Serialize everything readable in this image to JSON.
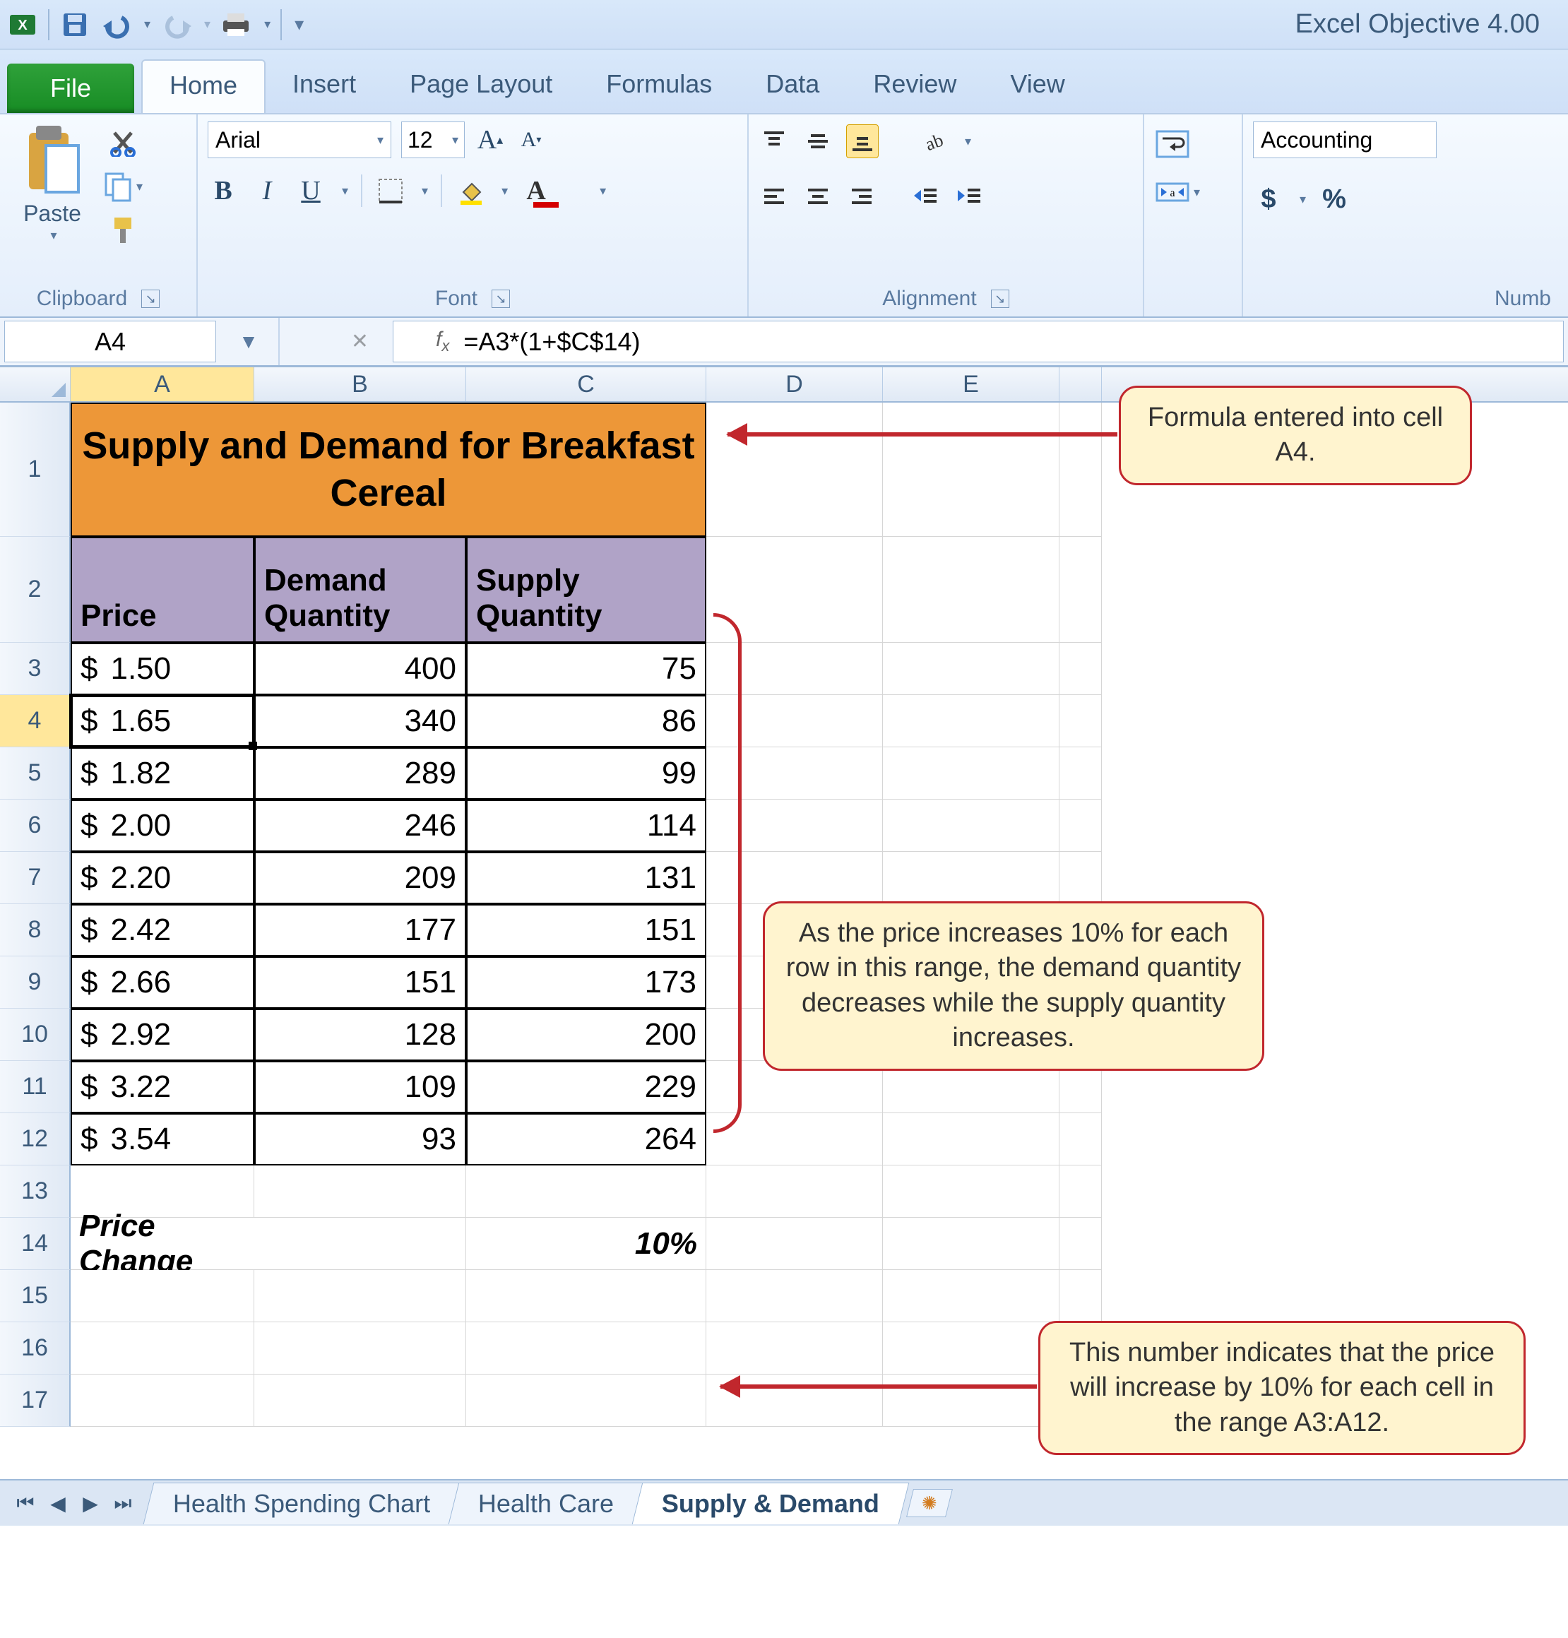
{
  "app_title": "Excel Objective 4.00",
  "tabs": {
    "file": "File",
    "items": [
      "Home",
      "Insert",
      "Page Layout",
      "Formulas",
      "Data",
      "Review",
      "View"
    ],
    "active": "Home"
  },
  "ribbon": {
    "clipboard": {
      "paste": "Paste",
      "label": "Clipboard"
    },
    "font": {
      "name": "Arial",
      "size": "12",
      "label": "Font"
    },
    "alignment": {
      "label": "Alignment"
    },
    "number": {
      "format": "Accounting",
      "label": "Numb"
    }
  },
  "name_box": "A4",
  "formula": "=A3*(1+$C$14)",
  "columns": [
    "A",
    "B",
    "C",
    "D",
    "E"
  ],
  "active_column": "A",
  "active_row": "4",
  "sheet": {
    "title": "Supply and Demand for Breakfast Cereal",
    "headers": {
      "price": "Price",
      "demand": "Demand Quantity",
      "supply": "Supply Quantity"
    },
    "rows": [
      {
        "n": "3",
        "price": "1.50",
        "demand": "400",
        "supply": "75"
      },
      {
        "n": "4",
        "price": "1.65",
        "demand": "340",
        "supply": "86"
      },
      {
        "n": "5",
        "price": "1.82",
        "demand": "289",
        "supply": "99"
      },
      {
        "n": "6",
        "price": "2.00",
        "demand": "246",
        "supply": "114"
      },
      {
        "n": "7",
        "price": "2.20",
        "demand": "209",
        "supply": "131"
      },
      {
        "n": "8",
        "price": "2.42",
        "demand": "177",
        "supply": "151"
      },
      {
        "n": "9",
        "price": "2.66",
        "demand": "151",
        "supply": "173"
      },
      {
        "n": "10",
        "price": "2.92",
        "demand": "128",
        "supply": "200"
      },
      {
        "n": "11",
        "price": "3.22",
        "demand": "109",
        "supply": "229"
      },
      {
        "n": "12",
        "price": "3.54",
        "demand": "93",
        "supply": "264"
      }
    ],
    "price_change_label": "Price Change",
    "price_change_value": "10%",
    "blank_rows": [
      "13",
      "15",
      "16",
      "17"
    ]
  },
  "sheet_tabs": {
    "items": [
      "Health Spending Chart",
      "Health Care",
      "Supply & Demand"
    ],
    "active": "Supply & Demand"
  },
  "callouts": {
    "c1": "Formula entered into cell A4.",
    "c2": "As the price increases 10% for each row in this range, the demand quantity decreases while the supply quantity increases.",
    "c3": "This number indicates that the price will increase by 10% for each cell in the range A3:A12."
  },
  "chart_data": {
    "type": "table",
    "title": "Supply and Demand for Breakfast Cereal",
    "columns": [
      "Price",
      "Demand Quantity",
      "Supply Quantity"
    ],
    "rows": [
      [
        1.5,
        400,
        75
      ],
      [
        1.65,
        340,
        86
      ],
      [
        1.82,
        289,
        99
      ],
      [
        2.0,
        246,
        114
      ],
      [
        2.2,
        209,
        131
      ],
      [
        2.42,
        177,
        151
      ],
      [
        2.66,
        151,
        173
      ],
      [
        2.92,
        128,
        200
      ],
      [
        3.22,
        109,
        229
      ],
      [
        3.54,
        93,
        264
      ]
    ],
    "parameters": {
      "Price Change": 0.1
    },
    "formula_A4": "=A3*(1+$C$14)"
  }
}
